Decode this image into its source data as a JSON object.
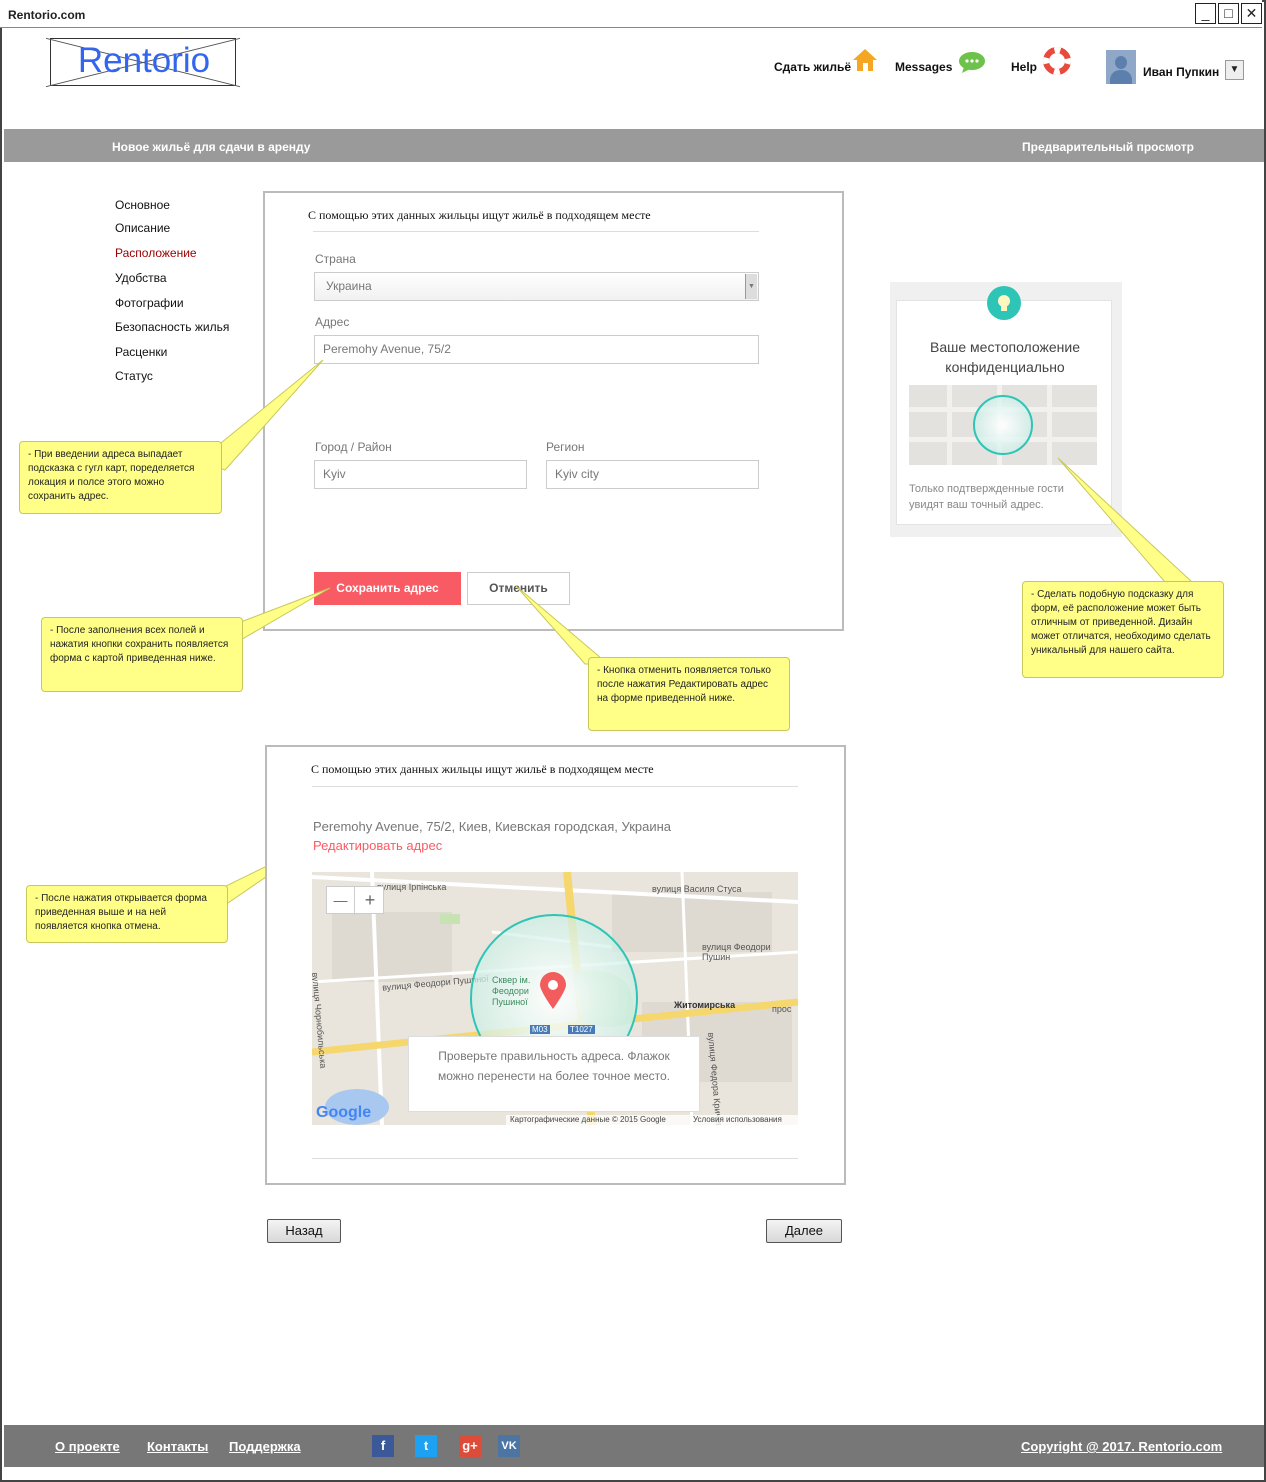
{
  "window": {
    "title": "Rentorio.com",
    "minimize_glyph": "_",
    "maximize_glyph": "□",
    "close_glyph": "✕"
  },
  "header": {
    "logo": "Rentorio",
    "rent_out_label": "Сдать жильё",
    "messages_label": "Messages",
    "help_label": "Help",
    "user_name": "Иван Пупкин",
    "dropdown_glyph": "▼"
  },
  "band": {
    "left_title": "Новое жильё для сдачи в аренду",
    "right_title": "Предварительный просмотр"
  },
  "sidebar": {
    "items": [
      {
        "label": "Основное"
      },
      {
        "label": "Описание"
      },
      {
        "label": "Расположение"
      },
      {
        "label": "Удобства"
      },
      {
        "label": "Фотографии"
      },
      {
        "label": "Безопасность жилья"
      },
      {
        "label": "Расценки"
      },
      {
        "label": "Статус"
      }
    ]
  },
  "form1": {
    "intro": "С помощью этих данных жильцы ищут жильё в подходящем месте",
    "country_label": "Страна",
    "country_value": "Украина",
    "address_label": "Адрес",
    "address_value": "Peremohy Avenue, 75/2",
    "city_label": "Город / Район",
    "city_value": "Kyiv",
    "region_label": "Регион",
    "region_value": "Kyiv city",
    "save_button": "Сохранить адрес",
    "cancel_button": "Отменить"
  },
  "form2": {
    "intro": "С помощью этих данных жильцы ищут жильё в подходящем месте",
    "full_address": "Peremohy Avenue, 75/2, Киев, Киевская городская, Украина",
    "edit_link": "Редактировать адрес",
    "map": {
      "zoom_out": "—",
      "zoom_in": "+",
      "check_text": "Проверьте правильность адреса. Флажок можно перенести на более точное место.",
      "google": "Google",
      "map_data": "Картографические данные © 2015 Google",
      "terms": "Условия использования",
      "street_labels": [
        "вулиця Василя Стуса",
        "вулиця Феодори Пушин",
        "вулиця Феодори Пушиної",
        "вулиця Чорнобильська",
        "вулиця Ірпінська",
        "Житомирська",
        "вулиця Федора Кричев",
        "Сквер ім. Феодори Пушиної",
        "М03",
        "Т1027",
        "прос"
      ]
    }
  },
  "hint": {
    "title": "Ваше местоположение конфиденциально",
    "text": "Только подтвержденные гости увидят ваш точный адрес."
  },
  "notes": {
    "note1": "- При введении адреса выпадает подсказка с гугл карт, поределяется локация и полсе этого можно сохранить адрес.",
    "note2": "- После заполнения всех полей и нажатия кнопки сохранить появляется форма с картой приведенная ниже.",
    "note3": "- Кнопка отменить появляется только после нажатия Редактировать адрес на форме приведенной ниже.",
    "note4": "- Сделать подобную подсказку для форм, её расположение может быть отличным от приведенной. Дизайн может отличатся, необходимо сделать уникальный для нашего сайта.",
    "note5": "- После нажатия открывается форма приведенная выше и на ней появляется кнопка отмена."
  },
  "nav_buttons": {
    "back": "Назад",
    "next": "Далее"
  },
  "footer": {
    "about": "О проекте",
    "contacts": "Контакты",
    "support": "Поддержка",
    "facebook": "f",
    "twitter": "t",
    "gplus": "g+",
    "vk": "VK",
    "copyright": "Copyright @ 2017. Rentorio.com"
  },
  "colors": {
    "accent_red": "#f95b64",
    "active_nav": "#990000",
    "note_yellow": "#ffff88",
    "teal": "#2ec4b6",
    "band_gray": "#9a9a9a"
  }
}
